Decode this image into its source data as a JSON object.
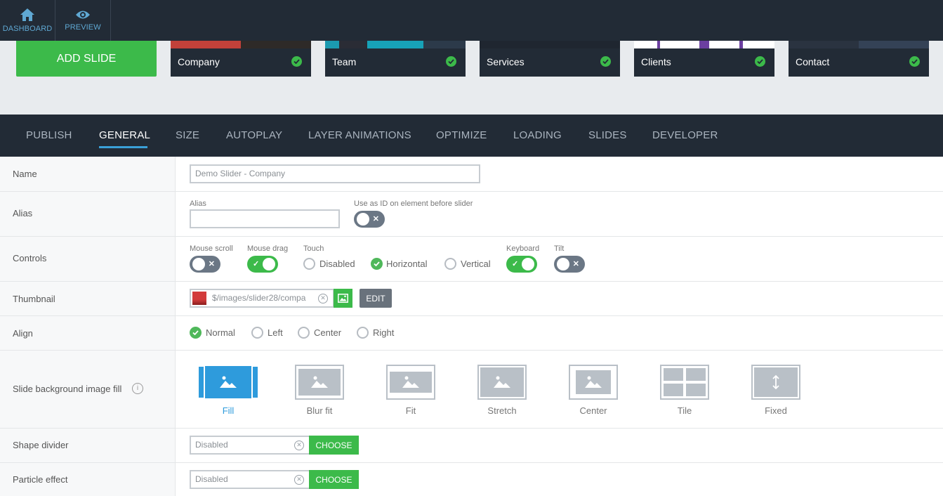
{
  "topnav": [
    {
      "label": "DASHBOARD",
      "icon": "home-icon"
    },
    {
      "label": "PREVIEW",
      "icon": "eye-icon"
    }
  ],
  "add_slide_label": "ADD SLIDE",
  "slides": [
    {
      "name": "Company",
      "status": "check-circle-icon"
    },
    {
      "name": "Team",
      "status": "check-circle-icon"
    },
    {
      "name": "Services",
      "status": "check-circle-icon"
    },
    {
      "name": "Clients",
      "status": "check-circle-icon"
    },
    {
      "name": "Contact",
      "status": "check-circle-icon"
    }
  ],
  "tabs": [
    "PUBLISH",
    "GENERAL",
    "SIZE",
    "AUTOPLAY",
    "LAYER ANIMATIONS",
    "OPTIMIZE",
    "LOADING",
    "SLIDES",
    "DEVELOPER"
  ],
  "active_tab": "GENERAL",
  "form": {
    "name": {
      "label": "Name",
      "value": "Demo Slider - Company"
    },
    "alias": {
      "label": "Alias",
      "field_label": "Alias",
      "value": "",
      "use_as_id_label": "Use as ID on element before slider",
      "use_as_id_on": false
    },
    "controls": {
      "label": "Controls",
      "mouse_scroll_label": "Mouse scroll",
      "mouse_scroll_on": false,
      "mouse_drag_label": "Mouse drag",
      "mouse_drag_on": true,
      "touch_label": "Touch",
      "touch_options": [
        "Disabled",
        "Horizontal",
        "Vertical"
      ],
      "touch_selected": "Horizontal",
      "keyboard_label": "Keyboard",
      "keyboard_on": true,
      "tilt_label": "Tilt",
      "tilt_on": false
    },
    "thumbnail": {
      "label": "Thumbnail",
      "value": "$/images/slider28/compa",
      "edit_label": "EDIT"
    },
    "align": {
      "label": "Align",
      "options": [
        "Normal",
        "Left",
        "Center",
        "Right"
      ],
      "selected": "Normal"
    },
    "bg_fill": {
      "label": "Slide background image fill",
      "info_icon": "info-icon",
      "options": [
        "Fill",
        "Blur fit",
        "Fit",
        "Stretch",
        "Center",
        "Tile",
        "Fixed"
      ],
      "selected": "Fill"
    },
    "shape_divider": {
      "label": "Shape divider",
      "value": "Disabled",
      "button": "CHOOSE"
    },
    "particle_effect": {
      "label": "Particle effect",
      "value": "Disabled",
      "button": "CHOOSE"
    }
  },
  "colors": {
    "accent_green": "#3cba4a",
    "accent_blue": "#2e9bdc",
    "dark_bar": "#222b36"
  }
}
